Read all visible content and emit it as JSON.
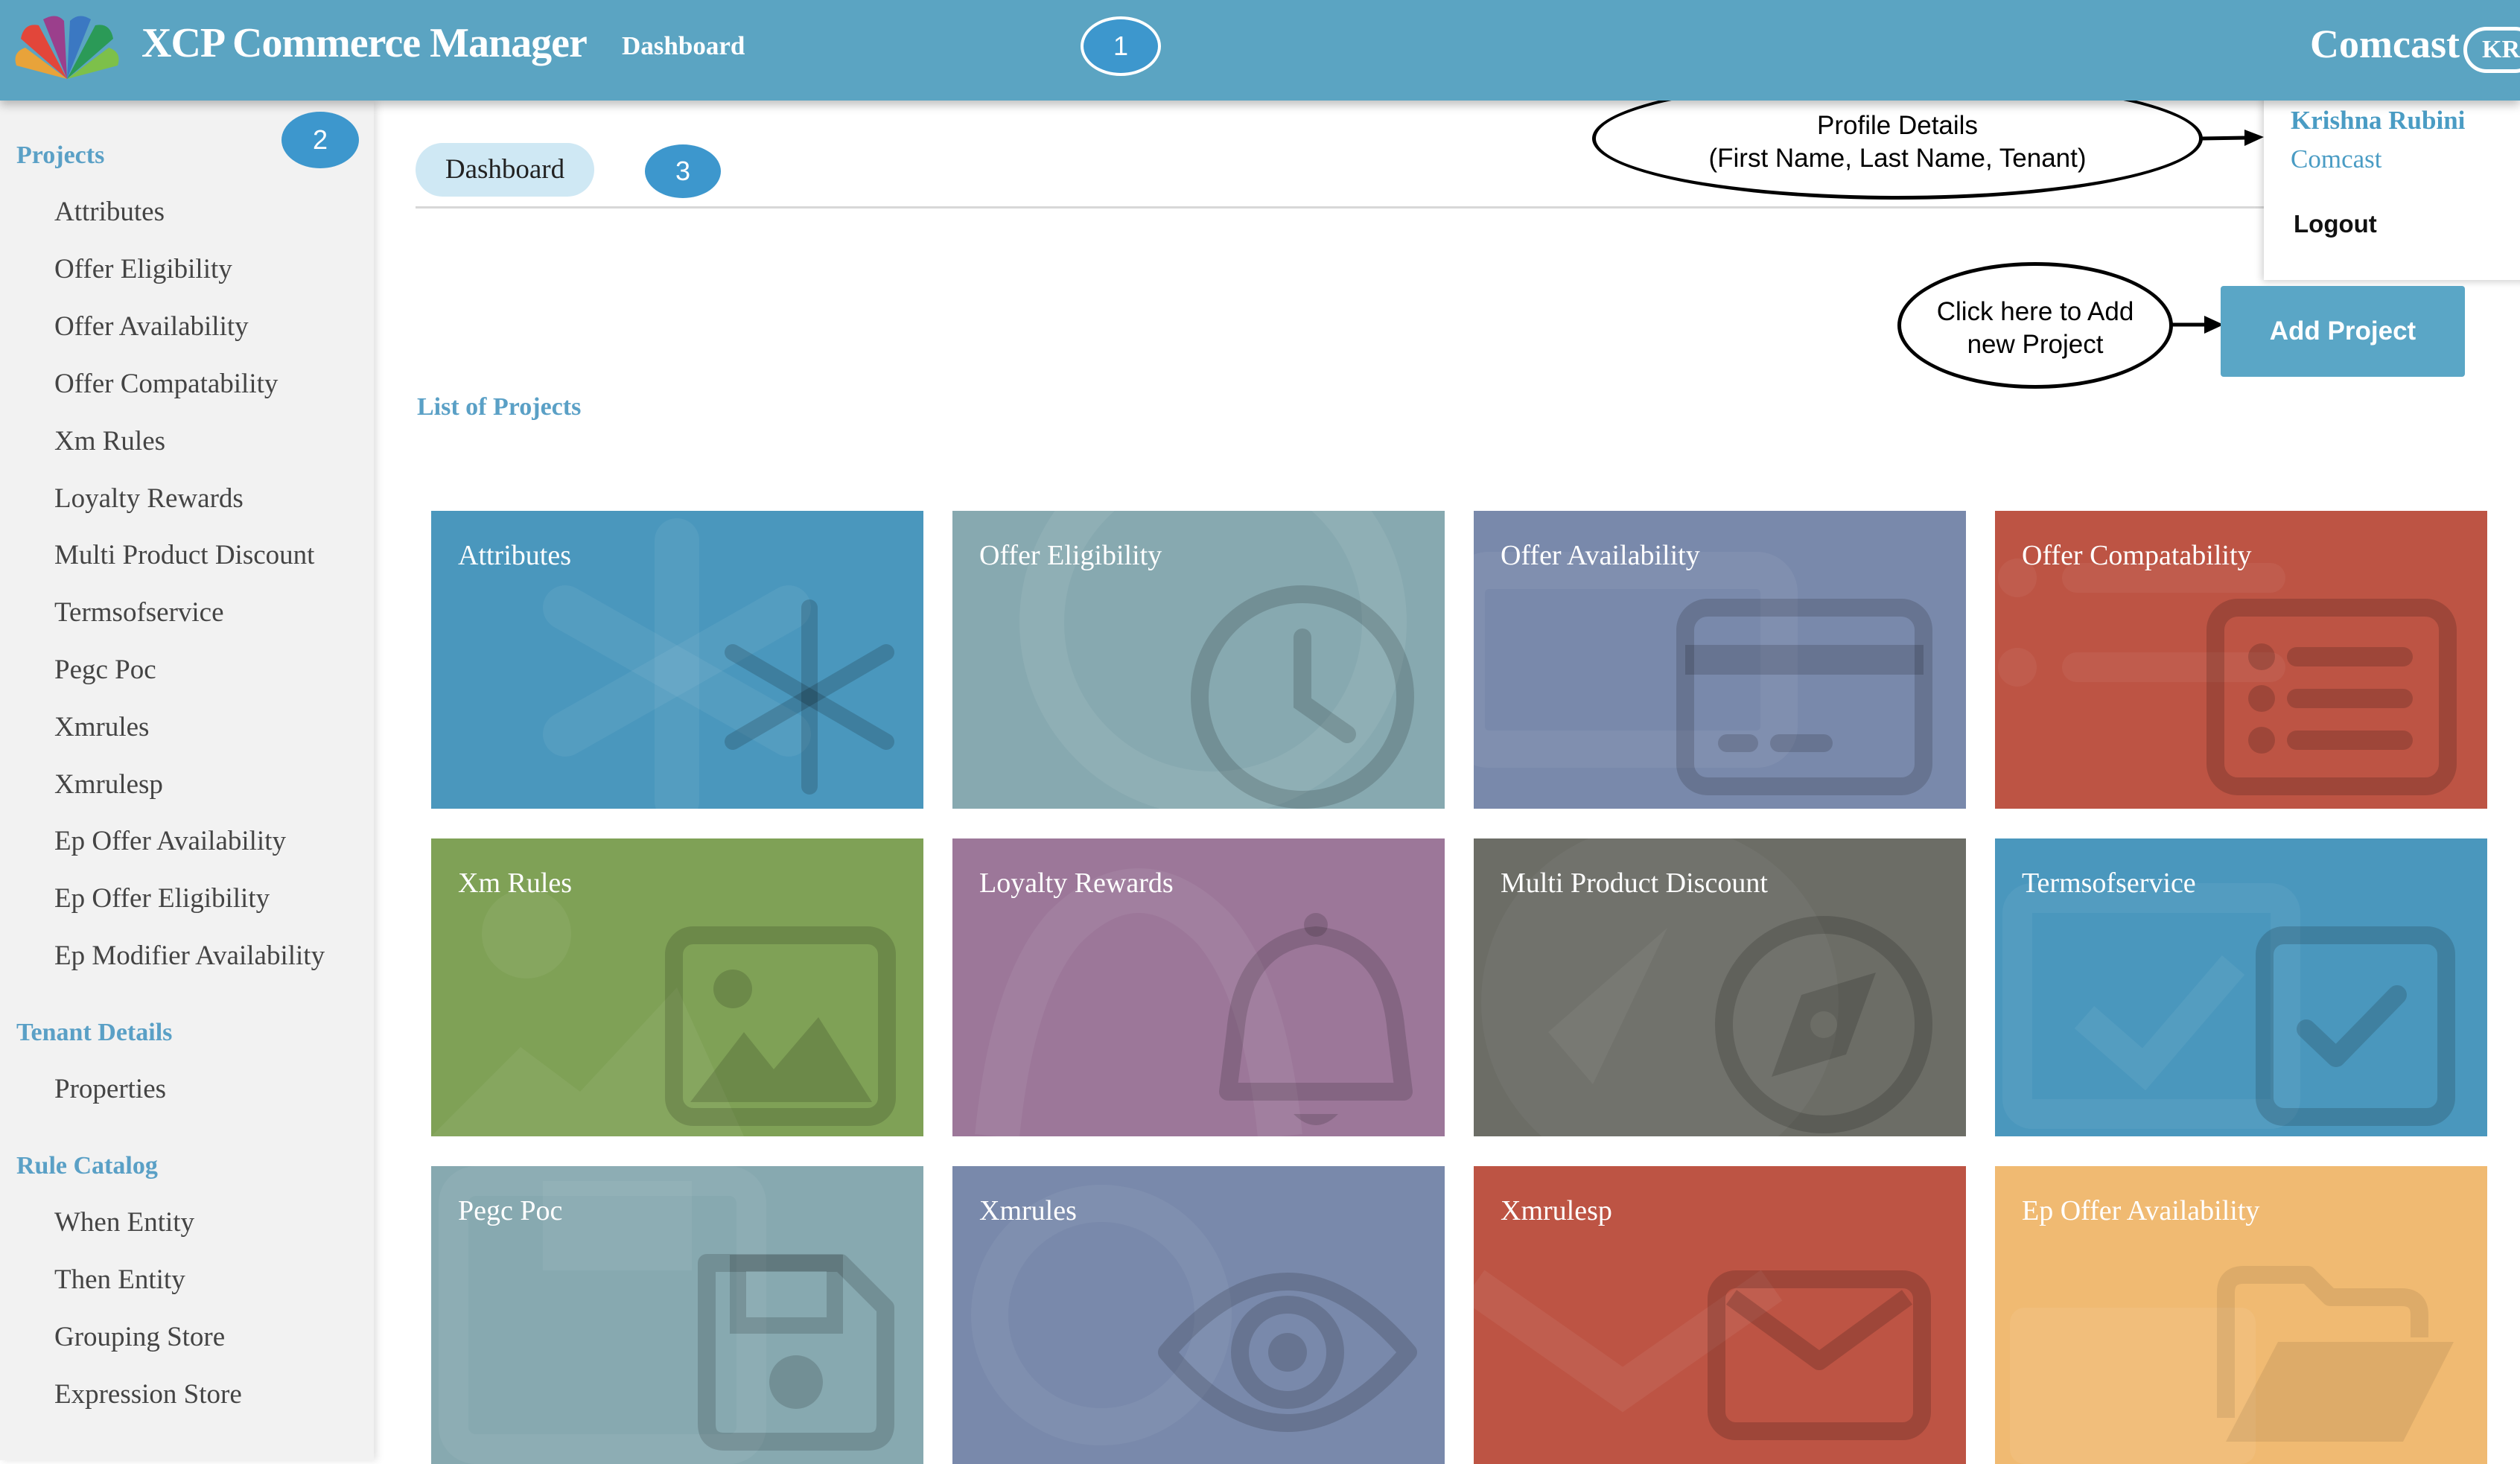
{
  "header": {
    "app_title": "XCP Commerce Manager",
    "nav_dashboard": "Dashboard",
    "tenant": "Comcast",
    "avatar_initials": "KR"
  },
  "callouts": {
    "c1": "1",
    "c2": "2",
    "c3": "3",
    "profile_line1": "Profile Details",
    "profile_line2": "(First Name, Last Name, Tenant)",
    "add_line1": "Click here to Add",
    "add_line2": "new Project"
  },
  "profile_menu": {
    "name": "Krishna Rubini",
    "tenant": "Comcast",
    "logout": "Logout"
  },
  "sidebar": {
    "projects_title": "Projects",
    "projects": [
      "Attributes",
      "Offer Eligibility",
      "Offer Availability",
      "Offer Compatability",
      "Xm Rules",
      "Loyalty Rewards",
      "Multi Product Discount",
      "Termsofservice",
      "Pegc Poc",
      "Xmrules",
      "Xmrulesp",
      "Ep Offer Availability",
      "Ep Offer Eligibility",
      "Ep Modifier Availability"
    ],
    "tenant_title": "Tenant Details",
    "tenant_items": [
      "Properties"
    ],
    "rule_title": "Rule Catalog",
    "rule_items": [
      "When Entity",
      "Then Entity",
      "Grouping Store",
      "Expression Store"
    ]
  },
  "main": {
    "tab": "Dashboard",
    "add_project": "Add Project",
    "list_title": "List of Projects",
    "tiles": [
      {
        "label": "Attributes",
        "color": "#4a97bd",
        "icon": "asterisk-icon"
      },
      {
        "label": "Offer Eligibility",
        "color": "#87a9b0",
        "icon": "clock-icon"
      },
      {
        "label": "Offer Availability",
        "color": "#7989ab",
        "icon": "credit-card-icon"
      },
      {
        "label": "Offer Compatability",
        "color": "#bd5444",
        "icon": "list-icon"
      },
      {
        "label": "Xm Rules",
        "color": "#7fa156",
        "icon": "image-icon"
      },
      {
        "label": "Loyalty Rewards",
        "color": "#9c7799",
        "icon": "bell-icon"
      },
      {
        "label": "Multi Product Discount",
        "color": "#6c6d66",
        "icon": "compass-icon"
      },
      {
        "label": "Termsofservice",
        "color": "#4a97bd",
        "icon": "checkbox-icon"
      },
      {
        "label": "Pegc Poc",
        "color": "#87a9b0",
        "icon": "floppy-disk-icon"
      },
      {
        "label": "Xmrules",
        "color": "#7989ab",
        "icon": "eye-icon"
      },
      {
        "label": "Xmrulesp",
        "color": "#bd5444",
        "icon": "envelope-icon"
      },
      {
        "label": "Ep Offer Availability",
        "color": "#f0ba72",
        "icon": "folder-open-icon"
      }
    ]
  }
}
